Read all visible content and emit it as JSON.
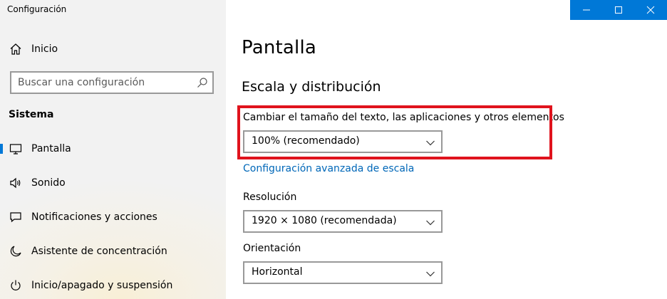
{
  "app": {
    "title": "Configuración"
  },
  "sidebar": {
    "home": {
      "label": "Inicio",
      "icon": "home-icon"
    },
    "search": {
      "placeholder": "Buscar una configuración",
      "icon": "search-icon"
    },
    "section": "Sistema",
    "items": [
      {
        "label": "Pantalla",
        "icon": "monitor-icon",
        "selected": true
      },
      {
        "label": "Sonido",
        "icon": "speaker-icon",
        "selected": false
      },
      {
        "label": "Notificaciones y acciones",
        "icon": "notification-icon",
        "selected": false
      },
      {
        "label": "Asistente de concentración",
        "icon": "moon-icon",
        "selected": false
      },
      {
        "label": "Inicio/apagado y suspensión",
        "icon": "power-icon",
        "selected": false
      }
    ]
  },
  "window_controls": {
    "minimize": "minimize-icon",
    "maximize": "maximize-icon",
    "close": "close-icon",
    "accent": "#0078d7"
  },
  "main": {
    "title": "Pantalla",
    "scale_section": {
      "title": "Escala y distribución",
      "scale_label": "Cambiar el tamaño del texto, las aplicaciones y otros elementos",
      "scale_value": "100% (recomendado)",
      "advanced_link": "Configuración avanzada de escala"
    },
    "resolution": {
      "label": "Resolución",
      "value": "1920 × 1080 (recomendada)"
    },
    "orientation": {
      "label": "Orientación",
      "value": "Horizontal"
    }
  },
  "highlight_color": "#e0131d"
}
